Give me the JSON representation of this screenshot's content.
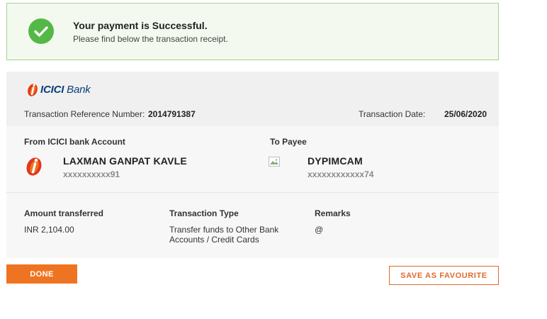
{
  "banner": {
    "title": "Your payment is Successful.",
    "subtitle": "Please find below the transaction receipt.",
    "icon": "check-circle-icon",
    "color": "#54b847"
  },
  "bank": {
    "logo_prefix": "ICICI",
    "logo_suffix": " Bank",
    "logo_color": "#0d3e7a",
    "logo_accent": "#e2361b"
  },
  "transaction": {
    "ref_label": "Transaction Reference Number:",
    "ref_value": "2014791387",
    "date_label": "Transaction Date:",
    "date_value": "25/06/2020"
  },
  "from": {
    "label": "From ICICI bank Account",
    "name": "LAXMAN GANPAT KAVLE",
    "account": "xxxxxxxxxx91"
  },
  "to": {
    "label": "To Payee",
    "name": "DYPIMCAM",
    "account": "xxxxxxxxxxxx74"
  },
  "details": {
    "amount_label": "Amount transferred",
    "amount_value": "INR 2,104.00",
    "type_label": "Transaction Type",
    "type_line1": "Transfer funds to Other Bank",
    "type_line2": "Accounts / Credit Cards",
    "remarks_label": "Remarks",
    "remarks_value": "@"
  },
  "actions": {
    "done_label": "DONE",
    "favourite_label": "SAVE AS FAVOURITE",
    "accent": "#ef7421"
  }
}
